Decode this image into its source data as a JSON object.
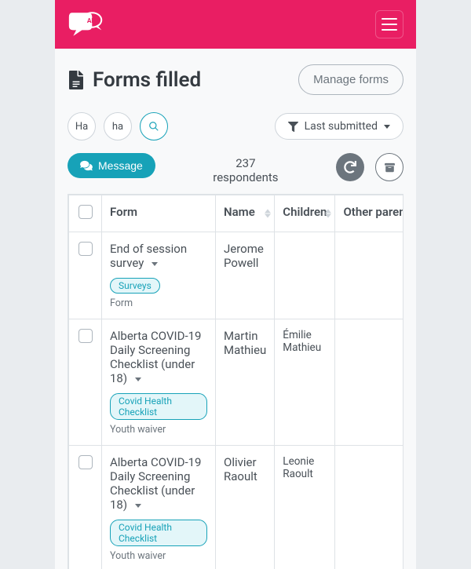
{
  "brand": {
    "initials": "AM"
  },
  "page": {
    "title": "Forms filled",
    "manage_button": "Manage forms"
  },
  "filters": {
    "pill1": "Ha",
    "pill2": "ha",
    "sort_label": "Last submitted"
  },
  "actions": {
    "message_label": "Message",
    "respondents_count": "237",
    "respondents_label": "respondents"
  },
  "table": {
    "headers": {
      "form": "Form",
      "name": "Name",
      "children": "Children",
      "other": "Other parent"
    },
    "rows": [
      {
        "form": "End of session survey",
        "tag": "Surveys",
        "subtype": "Form",
        "name": "Jerome Powell",
        "children": ""
      },
      {
        "form": "Alberta COVID-19 Daily Screening Checklist (under 18)",
        "tag": "Covid Health Checklist",
        "subtype": "Youth waiver",
        "name": "Martin Mathieu",
        "children": "Émilie Mathieu"
      },
      {
        "form": "Alberta COVID-19 Daily Screening Checklist (under 18)",
        "tag": "Covid Health Checklist",
        "subtype": "Youth waiver",
        "name": "Olivier Raoult",
        "children": "Leonie Raoult"
      }
    ]
  }
}
